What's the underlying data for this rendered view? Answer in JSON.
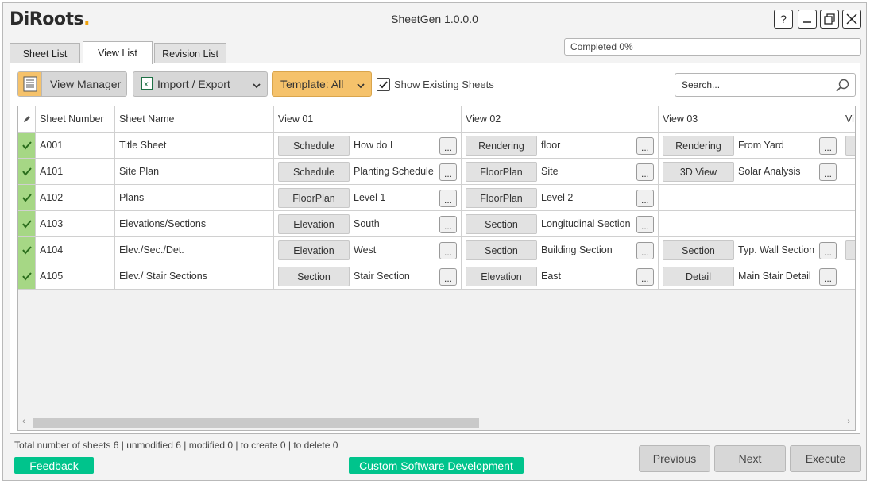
{
  "app": {
    "logo_text": "DiRoots",
    "title": "SheetGen 1.0.0.0",
    "window_controls": {
      "help": "?",
      "minimize": "–",
      "restore": "❐",
      "close": "✕"
    }
  },
  "tabs": [
    {
      "label": "Sheet List",
      "active": false
    },
    {
      "label": "View List",
      "active": true
    },
    {
      "label": "Revision List",
      "active": false
    }
  ],
  "progress": {
    "text": "Completed 0%",
    "value": 0
  },
  "toolbar": {
    "view_manager_label": "View Manager",
    "import_export_label": "Import / Export",
    "template_label": "Template: All",
    "show_existing_label": "Show Existing Sheets",
    "show_existing_checked": true,
    "search_placeholder": "Search..."
  },
  "grid": {
    "columns": [
      "",
      "Sheet Number",
      "Sheet Name",
      "View 01",
      "View 02",
      "View 03",
      "Vi"
    ],
    "rows": [
      {
        "number": "A001",
        "name": "Title Sheet",
        "v1": {
          "type": "Schedule",
          "name": "How do I"
        },
        "v2": {
          "type": "Rendering",
          "name": "floor"
        },
        "v3": {
          "type": "Rendering",
          "name": "From Yard"
        },
        "v4": true
      },
      {
        "number": "A101",
        "name": "Site Plan",
        "v1": {
          "type": "Schedule",
          "name": "Planting Schedule"
        },
        "v2": {
          "type": "FloorPlan",
          "name": "Site"
        },
        "v3": {
          "type": "3D View",
          "name": "Solar Analysis"
        },
        "v4": false
      },
      {
        "number": "A102",
        "name": "Plans",
        "v1": {
          "type": "FloorPlan",
          "name": "Level 1"
        },
        "v2": {
          "type": "FloorPlan",
          "name": "Level 2"
        },
        "v3": null,
        "v4": false
      },
      {
        "number": "A103",
        "name": "Elevations/Sections",
        "v1": {
          "type": "Elevation",
          "name": "South"
        },
        "v2": {
          "type": "Section",
          "name": "Longitudinal Section"
        },
        "v3": null,
        "v4": false
      },
      {
        "number": "A104",
        "name": "Elev./Sec./Det.",
        "v1": {
          "type": "Elevation",
          "name": "West"
        },
        "v2": {
          "type": "Section",
          "name": "Building Section"
        },
        "v3": {
          "type": "Section",
          "name": "Typ. Wall Section"
        },
        "v4": true
      },
      {
        "number": "A105",
        "name": "Elev./ Stair Sections",
        "v1": {
          "type": "Section",
          "name": "Stair Section"
        },
        "v2": {
          "type": "Elevation",
          "name": "East"
        },
        "v3": {
          "type": "Detail",
          "name": "Main Stair Detail"
        },
        "v4": false
      }
    ],
    "dots_label": "..."
  },
  "footer": {
    "summary": "Total number of sheets 6 | unmodified 6 | modified 0 | to create 0 | to delete 0",
    "feedback_label": "Feedback",
    "custom_dev_label": "Custom Software Development",
    "previous_label": "Previous",
    "next_label": "Next",
    "execute_label": "Execute"
  },
  "colors": {
    "accent_orange": "#f5c26b",
    "status_green": "#a6d785",
    "brand_green": "#00c48c"
  }
}
